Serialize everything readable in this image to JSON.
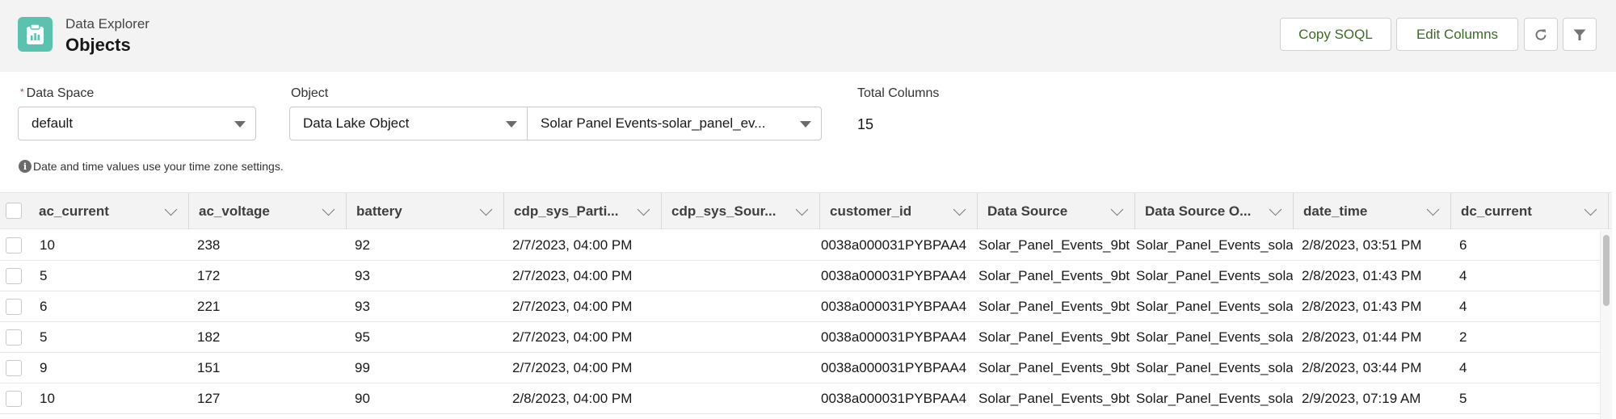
{
  "header": {
    "subtitle": "Data Explorer",
    "title": "Objects",
    "app_icon": "clipboard-chart-icon",
    "buttons": {
      "copy_soql": "Copy SOQL",
      "edit_columns": "Edit Columns",
      "refresh_icon": "refresh-icon",
      "filter_icon": "filter-icon"
    },
    "colors": {
      "app_icon_bg": "#5cc2b0",
      "button_text": "#3b6b22"
    }
  },
  "form": {
    "data_space": {
      "label": "Data Space",
      "required_marker": "*",
      "value": "default"
    },
    "object": {
      "label": "Object",
      "type_value": "Data Lake Object",
      "value": "Solar Panel Events-solar_panel_ev..."
    },
    "total_columns": {
      "label": "Total Columns",
      "value": "15"
    },
    "info_text": "Date and time values use your time zone settings."
  },
  "table": {
    "columns": [
      "ac_current",
      "ac_voltage",
      "battery",
      "cdp_sys_Parti...",
      "cdp_sys_Sour...",
      "customer_id",
      "Data Source",
      "Data Source O...",
      "date_time",
      "dc_current"
    ],
    "rows": [
      [
        "10",
        "238",
        "92",
        "2/7/2023, 04:00 PM",
        "",
        "0038a000031PYBPAA4",
        "Solar_Panel_Events_9bt",
        "Solar_Panel_Events_sola",
        "2/8/2023, 03:51 PM",
        "6"
      ],
      [
        "5",
        "172",
        "93",
        "2/7/2023, 04:00 PM",
        "",
        "0038a000031PYBPAA4",
        "Solar_Panel_Events_9bt",
        "Solar_Panel_Events_sola",
        "2/8/2023, 01:43 PM",
        "4"
      ],
      [
        "6",
        "221",
        "93",
        "2/7/2023, 04:00 PM",
        "",
        "0038a000031PYBPAA4",
        "Solar_Panel_Events_9bt",
        "Solar_Panel_Events_sola",
        "2/8/2023, 01:43 PM",
        "4"
      ],
      [
        "5",
        "182",
        "95",
        "2/7/2023, 04:00 PM",
        "",
        "0038a000031PYBPAA4",
        "Solar_Panel_Events_9bt",
        "Solar_Panel_Events_sola",
        "2/8/2023, 01:44 PM",
        "2"
      ],
      [
        "9",
        "151",
        "99",
        "2/7/2023, 04:00 PM",
        "",
        "0038a000031PYBPAA4",
        "Solar_Panel_Events_9bt",
        "Solar_Panel_Events_sola",
        "2/8/2023, 03:44 PM",
        "4"
      ],
      [
        "10",
        "127",
        "90",
        "2/8/2023, 04:00 PM",
        "",
        "0038a000031PYBPAA4",
        "Solar_Panel_Events_9bt",
        "Solar_Panel_Events_sola",
        "2/9/2023, 07:19 AM",
        "5"
      ]
    ]
  }
}
